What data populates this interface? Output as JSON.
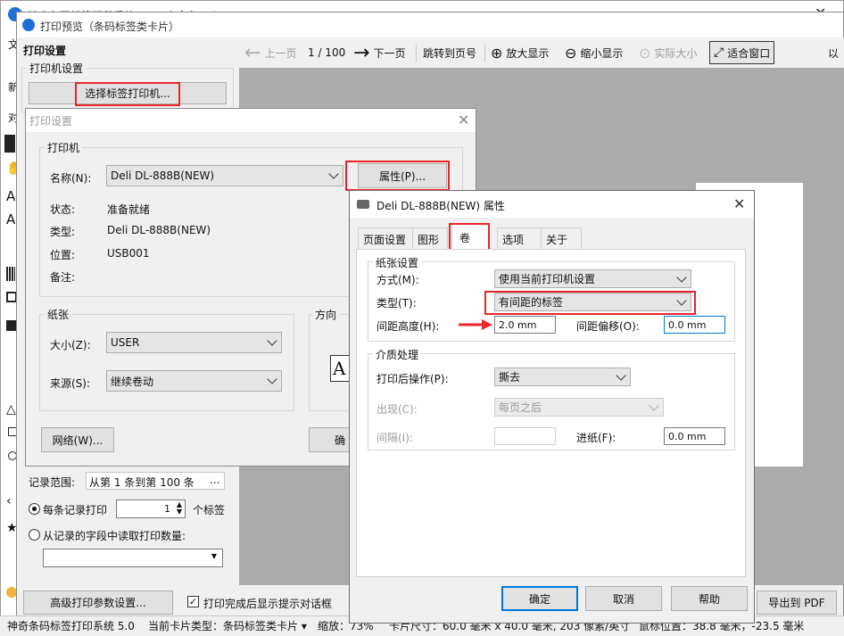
{
  "main_window": {
    "title": "神奇条码标签打印系统 5.0 - 未命名1.tlp",
    "left_frag": "文",
    "left_frag2": "新",
    "left_frag3": "对"
  },
  "preview_window": {
    "title": "打印预览（条码标签类卡片）",
    "print_settings_label": "打印设置",
    "printer_settings_label": "打印机设置",
    "select_printer_btn": "选择标签打印机...",
    "record_range_label": "记录范围:",
    "record_range_value": "从第 1 条到第 100 条",
    "record_range_more": "...",
    "per_record_label": "每条记录打印",
    "per_record_value": "1",
    "per_record_unit": "个标签",
    "from_field_label": "从记录的字段中读取打印数量:",
    "advanced_btn": "高级打印参数设置...",
    "show_dialog_label": "打印完成后显示提示对话框",
    "export_pdf_btn": "导出到 PDF",
    "toolbar": {
      "prev": "上一页",
      "page": "1 / 100",
      "next": "下一页",
      "goto": "跳转到页号",
      "zoom_in": "放大显示",
      "zoom_out": "缩小显示",
      "actual": "实际大小",
      "fit": "适合窗口",
      "more": "以"
    }
  },
  "status_bar": {
    "app": "神奇条码标签打印系统 5.0",
    "card_type": "当前卡片类型：条码标签类卡片 ▾",
    "zoom": "缩放：73%",
    "card_size": "卡片尺寸：60.0 毫米 x 40.0 毫米, 203 像素/英寸",
    "mouse": "鼠标位置：38.8 毫米，-23.5 毫米"
  },
  "print_setup_dialog": {
    "title": "打印设置",
    "printer_group": "打印机",
    "name_label": "名称(N):",
    "name_value": "Deli DL-888B(NEW)",
    "properties_btn": "属性(P)...",
    "status_label": "状态:",
    "status_value": "准备就绪",
    "type_label": "类型:",
    "type_value": "Deli DL-888B(NEW)",
    "location_label": "位置:",
    "location_value": "USB001",
    "comment_label": "备注:",
    "paper_group": "纸张",
    "size_label": "大小(Z):",
    "size_value": "USER",
    "source_label": "来源(S):",
    "source_value": "继续卷动",
    "orientation_group": "方向",
    "network_btn": "网络(W)...",
    "ok_btn_fragment": "确"
  },
  "props_dialog": {
    "title": "Deli DL-888B(NEW) 属性",
    "tabs": [
      "页面设置",
      "图形",
      "卷",
      "选项",
      "关于"
    ],
    "paper_group": "纸张设置",
    "method_label": "方式(M):",
    "method_value": "使用当前打印机设置",
    "type_label": "类型(T):",
    "type_value": "有间距的标签",
    "gap_height_label": "间距高度(H):",
    "gap_height_value": "2.0 mm",
    "gap_offset_label": "间距偏移(O):",
    "gap_offset_value": "0.0 mm",
    "media_group": "介质处理",
    "post_action_label": "打印后操作(P):",
    "post_action_value": "撕去",
    "occur_label": "出现(C):",
    "occur_value": "每页之后",
    "interval_label": "间隔(I):",
    "interval_value": "",
    "feed_label": "进纸(F):",
    "feed_value": "0.0 mm",
    "ok_btn": "确定",
    "cancel_btn": "取消",
    "help_btn": "帮助"
  },
  "colors": {
    "highlight_red": "#e8242c",
    "accent_blue": "#0078d7"
  }
}
